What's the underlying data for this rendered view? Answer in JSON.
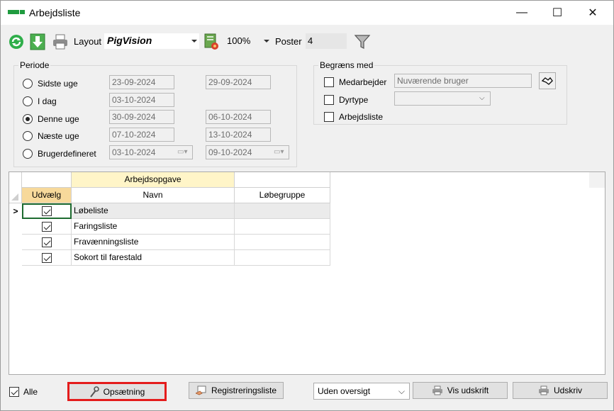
{
  "window": {
    "title": "Arbejdsliste",
    "minimize": "—",
    "maximize": "☐",
    "close": "✕"
  },
  "toolbar": {
    "layout_label": "Layout",
    "layout_value": "PigVision",
    "zoom_value": "100%",
    "poster_label": "Poster",
    "poster_value": "4"
  },
  "periode": {
    "title": "Periode",
    "options": [
      {
        "label": "Sidste uge",
        "from": "23-09-2024",
        "to": "29-09-2024",
        "selected": false
      },
      {
        "label": "I dag",
        "from": "03-10-2024",
        "to": "",
        "selected": false
      },
      {
        "label": "Denne uge",
        "from": "30-09-2024",
        "to": "06-10-2024",
        "selected": true
      },
      {
        "label": "Næste uge",
        "from": "07-10-2024",
        "to": "13-10-2024",
        "selected": false
      },
      {
        "label": "Brugerdefineret",
        "from": "03-10-2024",
        "to": "09-10-2024",
        "selected": false
      }
    ]
  },
  "begraens": {
    "title": "Begræns med",
    "medarbejder_label": "Medarbejder",
    "medarbejder_value": "Nuværende bruger",
    "dyrtype_label": "Dyrtype",
    "dyrtype_value": "",
    "arbejdsliste_label": "Arbejdsliste"
  },
  "grid": {
    "band_header": "Arbejdsopgave",
    "col_select": "Udvælg",
    "col_name": "Navn",
    "col_group": "Løbegruppe",
    "current_row_marker": ">",
    "rows": [
      {
        "name": "Løbeliste",
        "group": "",
        "checked": true
      },
      {
        "name": "Faringsliste",
        "group": "",
        "checked": true
      },
      {
        "name": "Fravænningsliste",
        "group": "",
        "checked": true
      },
      {
        "name": "Sokort til farestald",
        "group": "",
        "checked": true
      }
    ]
  },
  "bottom": {
    "alle_label": "Alle",
    "opsaetning_label": "Opsætning",
    "registreringsliste_label": "Registreringsliste",
    "oversigt_value": "Uden oversigt",
    "vis_udskrift_label": "Vis udskrift",
    "udskriv_label": "Udskriv"
  },
  "colors": {
    "accent_green": "#1f9b3f",
    "highlight_red": "#e41c1c",
    "header_yellow": "#fff5c8",
    "selected_header": "#f7d99b"
  }
}
